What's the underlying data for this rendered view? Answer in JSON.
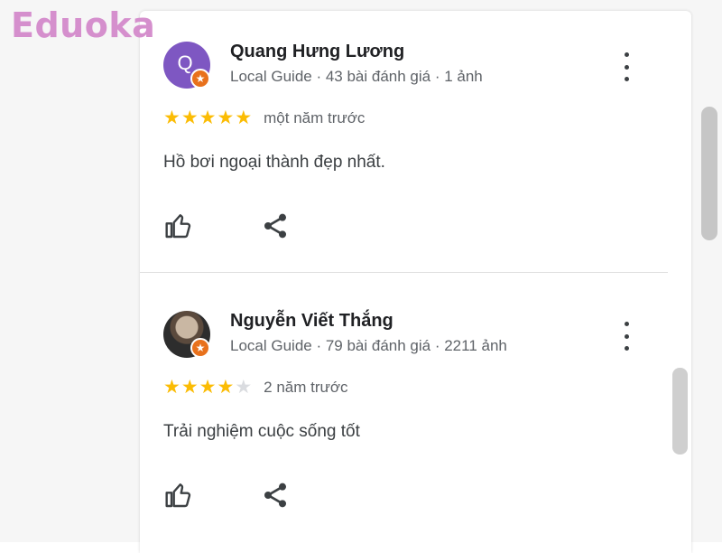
{
  "brand": {
    "logo_text": "Eduoka",
    "color": "#d58fcd"
  },
  "reviews": [
    {
      "reviewer": "Quang Hưng Lương",
      "avatar_letter": "Q",
      "avatar_color": "#7e57c2",
      "meta": "Local Guide · 43 bài đánh giá · 1 ảnh",
      "rating": 5,
      "date": "một năm trước",
      "text": "Hồ bơi ngoại thành đẹp nhất.",
      "icons": [
        "more-vert-icon",
        "thumbs-up-icon",
        "share-icon",
        "local-guide-star-icon"
      ]
    },
    {
      "reviewer": "Nguyễn Viết Thắng",
      "avatar_letter": "",
      "meta": "Local Guide · 79 bài đánh giá · 2211 ảnh",
      "rating": 4,
      "date": "2 năm trước",
      "text": "Trải nghiệm cuộc sống tốt",
      "icons": [
        "more-vert-icon",
        "thumbs-up-icon",
        "share-icon",
        "local-guide-star-icon"
      ]
    }
  ],
  "colors": {
    "star": "#fbbc04",
    "star_empty": "#dadce0",
    "badge": "#e8711c"
  }
}
